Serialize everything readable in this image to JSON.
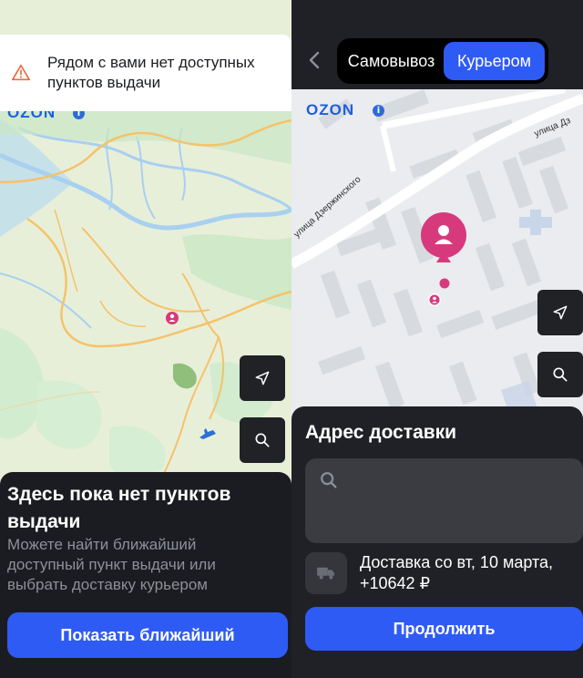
{
  "left": {
    "alert_text": "Рядом с вами нет доступных пунктов выдачи",
    "map_logo": "OZON",
    "sheet_title": "Здесь пока нет пунктов выдачи",
    "sheet_text": "Можете найти ближайший доступный пункт выдачи или выбрать доставку курьером",
    "show_nearest_button": "Показать ближайший",
    "icons": [
      "warning-icon",
      "navigation-arrow-icon",
      "search-icon",
      "airport-icon",
      "user-pin-icon"
    ]
  },
  "right": {
    "tabs": [
      {
        "label": "Самовывоз",
        "selected": false
      },
      {
        "label": "Курьером",
        "selected": true
      }
    ],
    "map_logo": "OZON",
    "street_labels": [
      "улица Дзержинского",
      "улица Дз"
    ],
    "sheet_title": "Адрес доставки",
    "address_value": "",
    "delivery_text": "Доставка со вт, 10 марта, +10642 ₽",
    "continue_button": "Продолжить",
    "icons": [
      "back-chevron-icon",
      "navigation-arrow-icon",
      "search-icon",
      "truck-icon",
      "user-pin-icon"
    ]
  },
  "colors": {
    "accent": "#2f5bf5",
    "pin": "#d63a7c",
    "warning": "#e9683f",
    "map_land": "#e8efd9",
    "map_water": "#a8d0ef",
    "map_road": "#f4c36a"
  }
}
